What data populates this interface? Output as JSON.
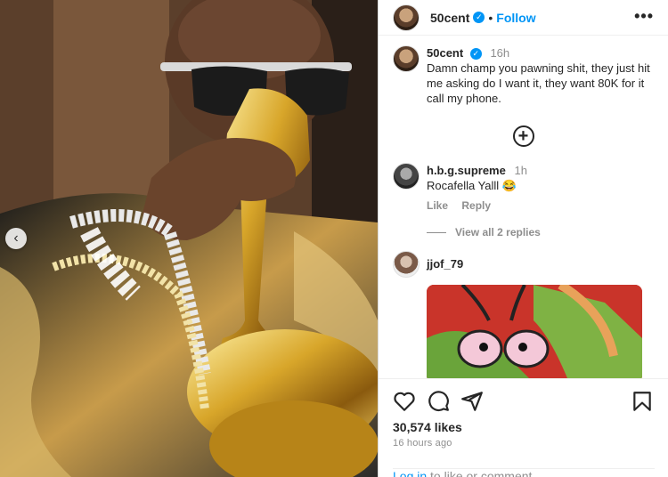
{
  "post": {
    "author": "50cent",
    "follow_label": "Follow",
    "dot": "•",
    "more": "•••"
  },
  "comments": [
    {
      "user": "50cent",
      "time": "16h",
      "text": "Damn champ you pawning shit, they just hit me asking do I want it, they want 80K for it call my phone."
    },
    {
      "user": "h.b.g.supreme",
      "time": "1h",
      "text": "Rocafella Yalll 😂",
      "like_label": "Like",
      "reply_label": "Reply",
      "view_replies": "View all 2 replies"
    },
    {
      "user": "jjof_79",
      "time": ""
    }
  ],
  "footer": {
    "likes": "30,574 likes",
    "ago": "16 hours ago",
    "login_link": "Log in",
    "login_rest": " to like or comment."
  },
  "colors": {
    "link": "#0095f6",
    "muted": "#8e8e8e",
    "text": "#262626"
  },
  "icons": [
    "heart-icon",
    "comment-icon",
    "share-icon",
    "bookmark-icon",
    "plus-circle-icon",
    "chevron-left-icon",
    "verified-icon"
  ]
}
